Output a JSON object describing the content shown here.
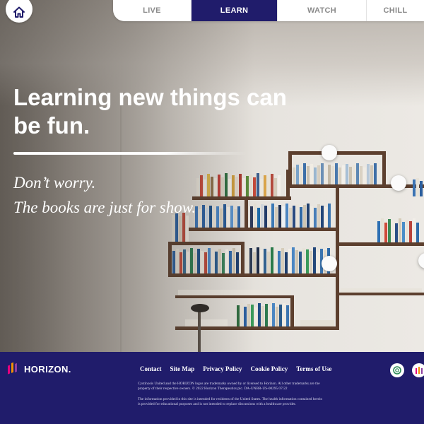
{
  "nav": {
    "tabs": [
      {
        "label": "LIVE",
        "active": false
      },
      {
        "label": "LEARN",
        "active": true
      },
      {
        "label": "WATCH",
        "active": false
      },
      {
        "label": "CHILL",
        "active": false
      }
    ],
    "home_icon": "home-icon"
  },
  "hero": {
    "headline": "Learning new things can be fun.",
    "tagline_1": "Don’t worry.",
    "tagline_2": "The books are just for show."
  },
  "footer": {
    "logo_text": "HORIZON.",
    "links": [
      "Contact",
      "Site Map",
      "Privacy Policy",
      "Cookie Policy",
      "Terms of Use"
    ],
    "legal_1": "Cystinosis United and the HORIZON logos are trademarks owned by or licensed to Horizon. All other trademarks are the property of their respective owners. © 2022 Horizon Therapeutics plc. DA-UNBR-US-00295 07/22",
    "legal_2": "The information provided in this site is intended for residents of the United States. The health information contained herein is provided for educational purposes and is not intended to replace discussions with a healthcare provider."
  },
  "colors": {
    "brand_navy": "#201c6b",
    "white": "#ffffff",
    "shelf_wood": "#5c3f2e"
  }
}
